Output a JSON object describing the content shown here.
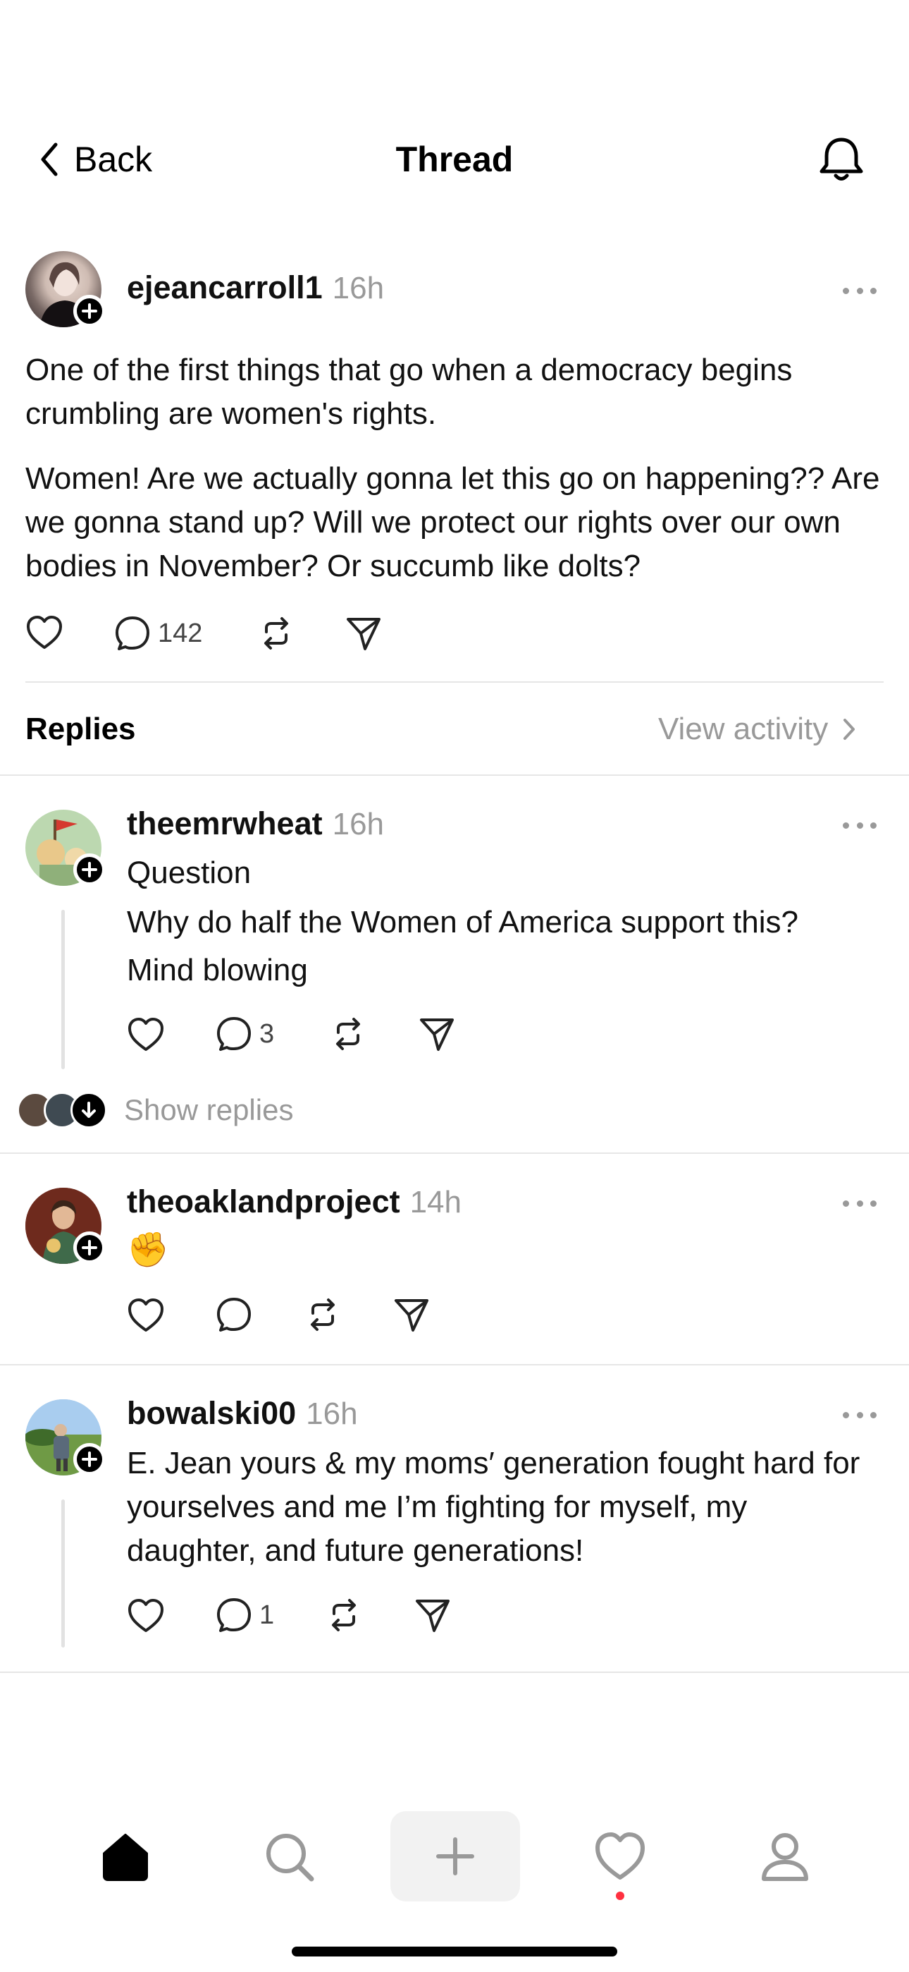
{
  "header": {
    "back_label": "Back",
    "title": "Thread",
    "bell_icon": "bell-icon"
  },
  "main_post": {
    "username": "ejeancarroll1",
    "time": "16h",
    "paragraph1": "One of the first things that go when a democracy begins crumbling are women's rights.",
    "paragraph2": "Women! Are we actually gonna let this go on happening?? Are we gonna stand up?  Will we protect our rights over our own bodies in November? Or succumb like dolts?",
    "reply_count": "142"
  },
  "replies_header": {
    "label": "Replies",
    "view_activity": "View activity"
  },
  "replies": [
    {
      "username": "theemrwheat",
      "time": "16h",
      "line1": "Question",
      "line2": "Why do half the Women of America support this?",
      "line3": "Mind blowing",
      "reply_count": "3",
      "show_replies": "Show replies"
    },
    {
      "username": "theoaklandproject",
      "time": "14h",
      "text": "✊"
    },
    {
      "username": "bowalski00",
      "time": "16h",
      "text": "E. Jean yours & my moms′ generation fought hard for yourselves and me I’m fighting for myself, my daughter, and future generations!",
      "reply_count": "1"
    }
  ],
  "tab_bar": {
    "items": [
      "home-icon",
      "search-icon",
      "compose-icon",
      "heart-icon",
      "profile-icon"
    ],
    "notification_dot_color": "#ff3040"
  },
  "colors": {
    "muted": "#999999",
    "divider": "#e6e6e6",
    "compose_bg": "#f2f2f2"
  }
}
